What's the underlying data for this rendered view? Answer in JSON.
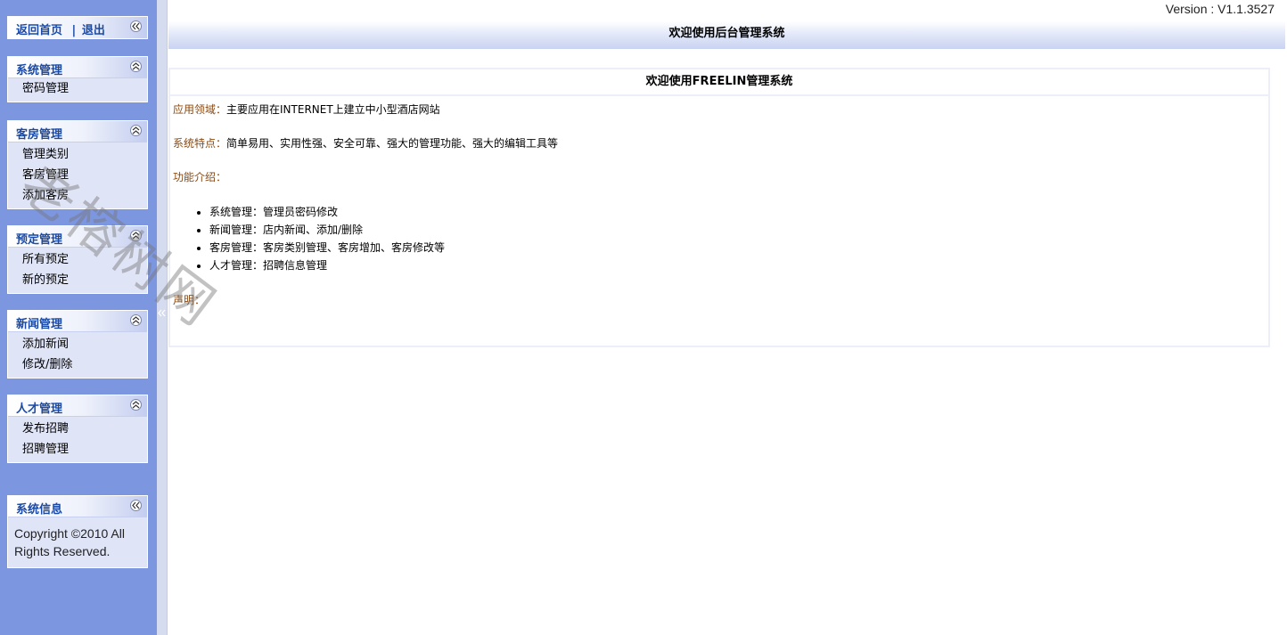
{
  "version": "Version : V1.1.3527",
  "header": {
    "title": "欢迎使用后台管理系统"
  },
  "nav": {
    "home": "返回首页",
    "separator": "|",
    "logout": "退出"
  },
  "sidebar": {
    "panels": [
      {
        "title": "系统管理",
        "items": [
          "密码管理"
        ]
      },
      {
        "title": "客房管理",
        "items": [
          "管理类别",
          "客房管理",
          "添加客房"
        ]
      },
      {
        "title": "预定管理",
        "items": [
          "所有预定",
          "新的预定"
        ]
      },
      {
        "title": "新闻管理",
        "items": [
          "添加新闻",
          "修改/删除"
        ]
      },
      {
        "title": "人才管理",
        "items": [
          "发布招聘",
          "招聘管理"
        ]
      }
    ],
    "sysinfo": {
      "title": "系统信息",
      "line1": "Copyright ©2010 All",
      "line2": "Rights Reserved."
    }
  },
  "main": {
    "box_title": "欢迎使用FREELIN管理系统",
    "field_label": "应用领域：",
    "field_value": "主要应用在INTERNET上建立中小型酒店网站",
    "features_label": "系统特点：",
    "features_value": "简单易用、实用性强、安全可靠、强大的管理功能、强大的编辑工具等",
    "intro_label": "功能介绍：",
    "intro_items": [
      "系统管理：管理员密码修改",
      "新闻管理：店内新闻、添加/删除",
      "客房管理：客房类别管理、客房增加、客房修改等",
      "人才管理：招聘信息管理"
    ],
    "statement_label": "声明："
  },
  "watermark": "老榕树网"
}
